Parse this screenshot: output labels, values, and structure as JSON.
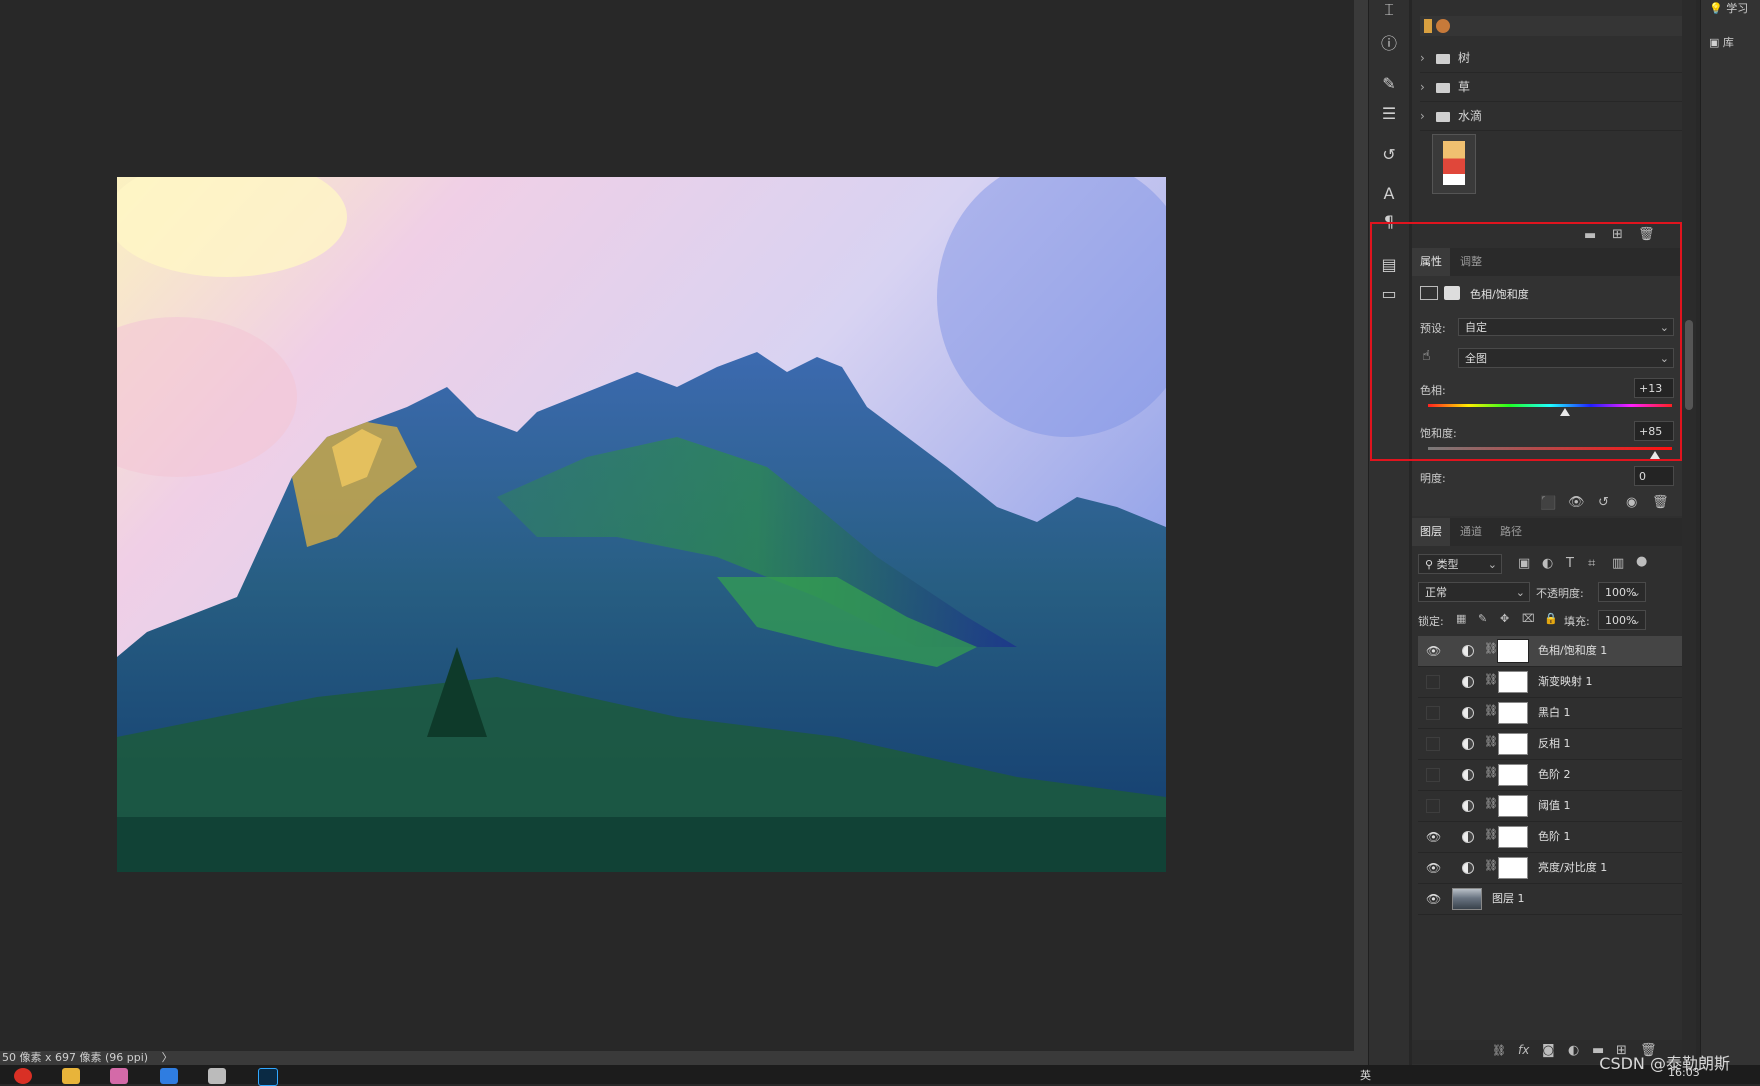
{
  "status_bar": {
    "doc_info": "50 像素 x 697 像素 (96 ppi)",
    "arrow": "〉"
  },
  "right_rail": {
    "item1": "学习",
    "item2": "库"
  },
  "libraries": {
    "folders": [
      "树",
      "草",
      "水滴"
    ]
  },
  "properties": {
    "tabs": [
      "属性",
      "调整"
    ],
    "adjustment_title": "色相/饱和度",
    "preset_label": "预设:",
    "preset_value": "自定",
    "channel_value": "全图",
    "hue_label": "色相:",
    "hue_value": "+13",
    "hue_level": 0.56,
    "saturation_label": "饱和度:",
    "saturation_value": "+85",
    "saturation_level": 0.93,
    "lightness_label": "明度:",
    "lightness_value": "0"
  },
  "layers_panel": {
    "tabs": [
      "图层",
      "通道",
      "路径"
    ],
    "filter_kind": "类型",
    "blend_mode": "正常",
    "opacity_label": "不透明度:",
    "opacity_value": "100%",
    "lock_label": "锁定:",
    "fill_label": "填充:",
    "fill_value": "100%",
    "layers": [
      {
        "name": "色相/饱和度 1",
        "visible": true,
        "selected": true
      },
      {
        "name": "渐变映射 1",
        "visible": false
      },
      {
        "name": "黑白 1",
        "visible": false
      },
      {
        "name": "反相 1",
        "visible": false
      },
      {
        "name": "色阶 2",
        "visible": false
      },
      {
        "name": "阈值 1",
        "visible": false
      },
      {
        "name": "色阶 1",
        "visible": true
      },
      {
        "name": "亮度/对比度 1",
        "visible": true
      },
      {
        "name": "图层 1",
        "visible": true,
        "is_image": true
      }
    ]
  },
  "taskbar": {
    "clock": "16:03",
    "input_method": "英"
  },
  "watermark": "CSDN @泰勒朗斯",
  "colors": {
    "highlight": "#e0141e",
    "panel_bg": "#2f2f2f",
    "canvas_bg": "#282828"
  }
}
